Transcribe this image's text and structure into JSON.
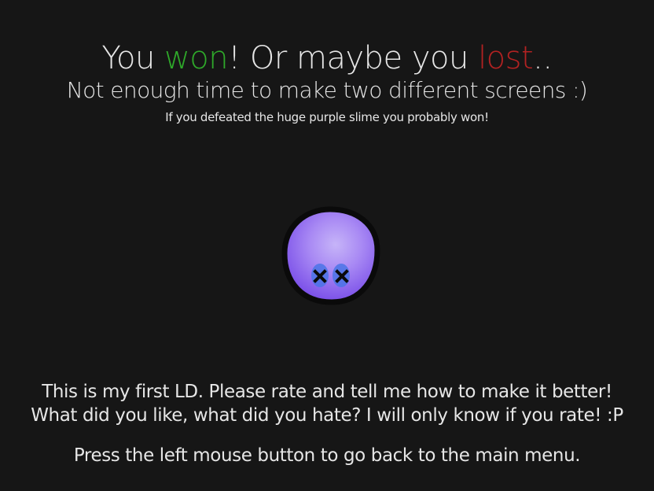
{
  "headline": {
    "part1": "You ",
    "won": "won",
    "part2": "! Or maybe you ",
    "lost": "lost",
    "part3": ".."
  },
  "subline": "Not enough time to make two different screens :)",
  "hint": "If you defeated the huge purple slime you probably won!",
  "slime": {
    "icon": "dead-purple-slime-icon",
    "body_color": "#9a6cf2",
    "outline_color": "#0a0a0a",
    "eye_color": "#3f6fe0"
  },
  "footer": {
    "rate_line1": "This is my first LD. Please rate and tell me how to make it better!",
    "rate_line2": "What did you like, what did you hate? I will only know if you rate! :P",
    "menu_hint": "Press the left mouse button to go back to the main menu."
  },
  "colors": {
    "background": "#161616",
    "text": "#e6e6e6",
    "won": "#2fa82a",
    "lost": "#b22222"
  }
}
